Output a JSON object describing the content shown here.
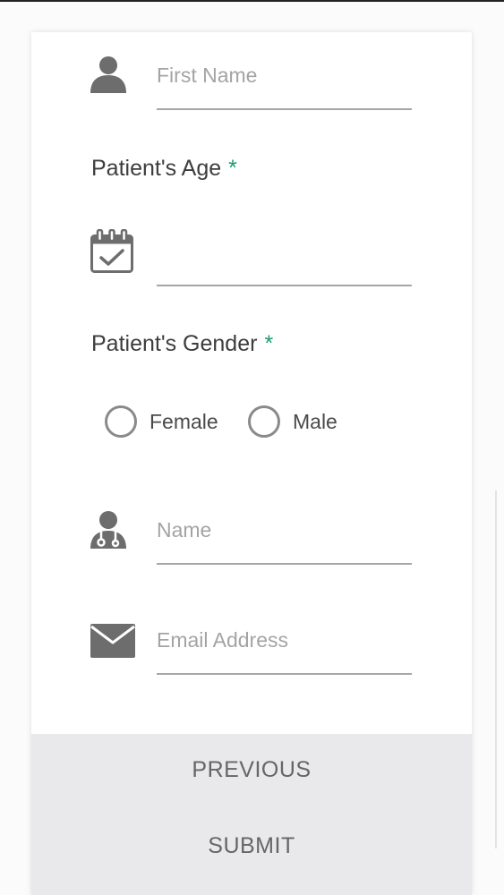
{
  "form": {
    "first_name": {
      "placeholder": "First Name",
      "value": ""
    },
    "age": {
      "label": "Patient's Age",
      "required_mark": "*",
      "value": ""
    },
    "gender": {
      "label": "Patient's Gender",
      "required_mark": "*",
      "options": [
        "Female",
        "Male"
      ]
    },
    "doctor_name": {
      "placeholder": "Name",
      "value": ""
    },
    "email": {
      "placeholder": "Email Address",
      "value": ""
    }
  },
  "actions": {
    "previous_label": "PREVIOUS",
    "submit_label": "SUBMIT"
  },
  "icons": {
    "first_name": "person-icon",
    "age": "calendar-check-icon",
    "doctor_name": "doctor-icon",
    "email": "envelope-icon"
  },
  "colors": {
    "required": "#1a9b73",
    "icon": "#6d6d6d",
    "footer_bg": "#e9e8ea"
  }
}
